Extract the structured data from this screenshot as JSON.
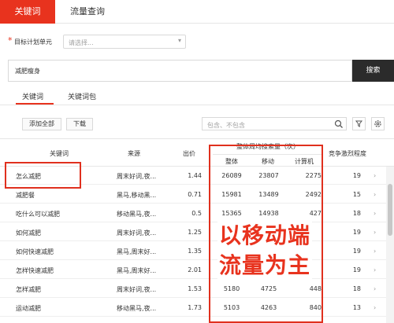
{
  "top_tabs": [
    {
      "label": "关键词",
      "active": true
    },
    {
      "label": "流量查询",
      "active": false
    }
  ],
  "target_unit": {
    "required_mark": "*",
    "label": "目标计划单元",
    "placeholder": "请选择..."
  },
  "search": {
    "value": "减肥瘦身",
    "button": "搜索"
  },
  "sub_tabs": [
    {
      "label": "关键词",
      "active": true
    },
    {
      "label": "关键词包",
      "active": false
    }
  ],
  "toolbar": {
    "add_all": "添加全部",
    "download": "下载",
    "filter_placeholder": "包含、不包含"
  },
  "table": {
    "headers": {
      "keyword": "关键词",
      "source": "来源",
      "bid": "出价",
      "weekly_group": "整体周均搜索量（次）",
      "overall": "整体",
      "mobile": "移动",
      "pc": "计算机",
      "competition": "竞争激烈程度"
    },
    "rows": [
      {
        "keyword": "怎么减肥",
        "source": "周末好词,夜...",
        "bid": "1.44",
        "overall": "26089",
        "mobile": "23807",
        "pc": "2275",
        "competition": "19"
      },
      {
        "keyword": "减肥餐",
        "source": "黑马,移动黑...",
        "bid": "0.71",
        "overall": "15981",
        "mobile": "13489",
        "pc": "2492",
        "competition": "15"
      },
      {
        "keyword": "吃什么可以减肥",
        "source": "移动黑马,夜...",
        "bid": "0.5",
        "overall": "15365",
        "mobile": "14938",
        "pc": "427",
        "competition": "18"
      },
      {
        "keyword": "如何减肥",
        "source": "周末好词,夜...",
        "bid": "1.25",
        "overall": "",
        "mobile": "",
        "pc": "",
        "competition": "19"
      },
      {
        "keyword": "如何快速减肥",
        "source": "黑马,周末好...",
        "bid": "1.35",
        "overall": "",
        "mobile": "",
        "pc": "",
        "competition": "19"
      },
      {
        "keyword": "怎样快速减肥",
        "source": "黑马,周末好...",
        "bid": "2.01",
        "overall": "",
        "mobile": "",
        "pc": "",
        "competition": "19"
      },
      {
        "keyword": "怎样减肥",
        "source": "周末好词,夜...",
        "bid": "1.53",
        "overall": "5180",
        "mobile": "4725",
        "pc": "448",
        "competition": "18"
      },
      {
        "keyword": "运动减肥",
        "source": "移动黑马,夜...",
        "bid": "1.73",
        "overall": "5103",
        "mobile": "4263",
        "pc": "840",
        "competition": "13"
      }
    ]
  },
  "overlay": {
    "line1": "以移动端",
    "line2": "流量为主"
  },
  "colors": {
    "accent": "#e8331e",
    "search_button": "#2b2b2b"
  }
}
